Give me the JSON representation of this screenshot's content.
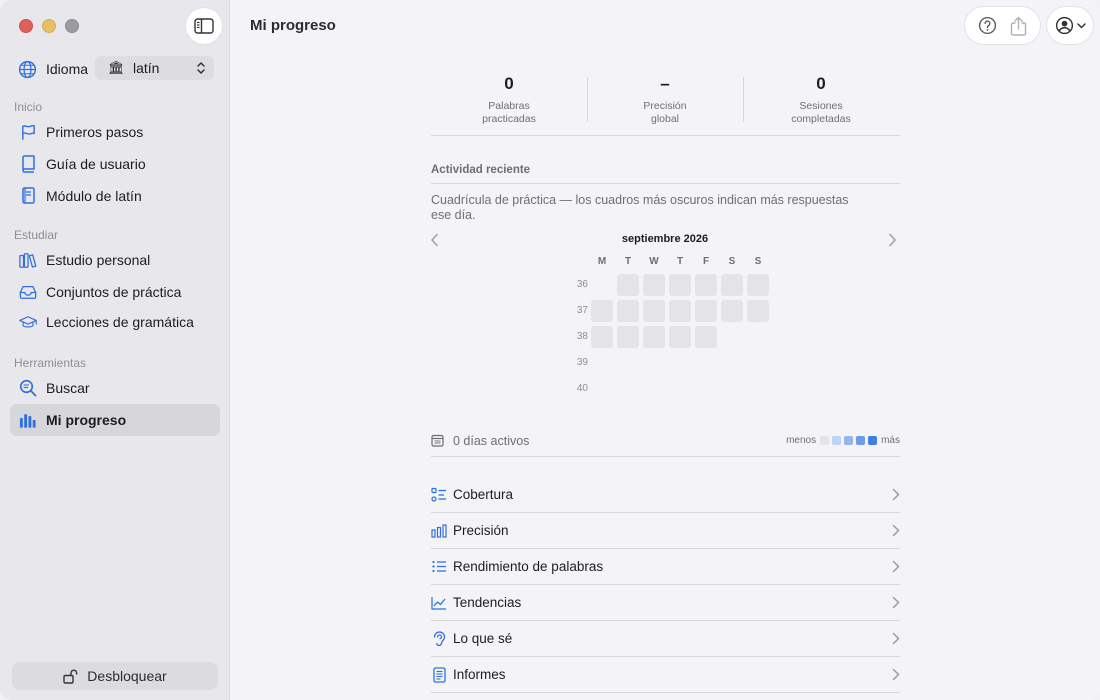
{
  "sidebar": {
    "language_label": "Idioma",
    "language_value": "latín",
    "sections": {
      "inicio": "Inicio",
      "estudiar": "Estudiar",
      "herramientas": "Herramientas"
    },
    "items": {
      "primeros_pasos": "Primeros pasos",
      "guia": "Guía de usuario",
      "modulo": "Módulo de latín",
      "estudio": "Estudio personal",
      "conjuntos": "Conjuntos de práctica",
      "lecciones": "Lecciones de gramática",
      "buscar": "Buscar",
      "progreso": "Mi progreso"
    },
    "unlock_label": "Desbloquear"
  },
  "header": {
    "title": "Mi progreso"
  },
  "stats": [
    {
      "value": "0",
      "label_1": "Palabras",
      "label_2": "practicadas"
    },
    {
      "value": "–",
      "label_1": "Precisión",
      "label_2": "global"
    },
    {
      "value": "0",
      "label_1": "Sesiones",
      "label_2": "completadas"
    }
  ],
  "activity": {
    "heading": "Actividad reciente",
    "description": "Cuadrícula de práctica — los cuadros más oscuros indican más respuestas ese día.",
    "month": "septiembre 2026",
    "weekdays": [
      "M",
      "T",
      "W",
      "T",
      "F",
      "S",
      "S"
    ],
    "weeks": [
      "36",
      "37",
      "38",
      "39",
      "40"
    ],
    "active_days_text": "0 días activos",
    "active_days_count": 0,
    "legend_less": "menos",
    "legend_more": "más",
    "legend_colors": [
      "#e4e4e8",
      "#bcd3f6",
      "#92b7ef",
      "#6a9ce9",
      "#3f7fe3"
    ]
  },
  "links": {
    "cobertura": "Cobertura",
    "precision": "Precisión",
    "rendimiento": "Rendimiento de palabras",
    "tendencias": "Tendencias",
    "lo_que_se": "Lo que sé",
    "informes": "Informes"
  },
  "colors": {
    "accent": "#2f6fde",
    "sidebar_bg": "#e8e8ec",
    "main_bg": "#f4f4f8"
  }
}
